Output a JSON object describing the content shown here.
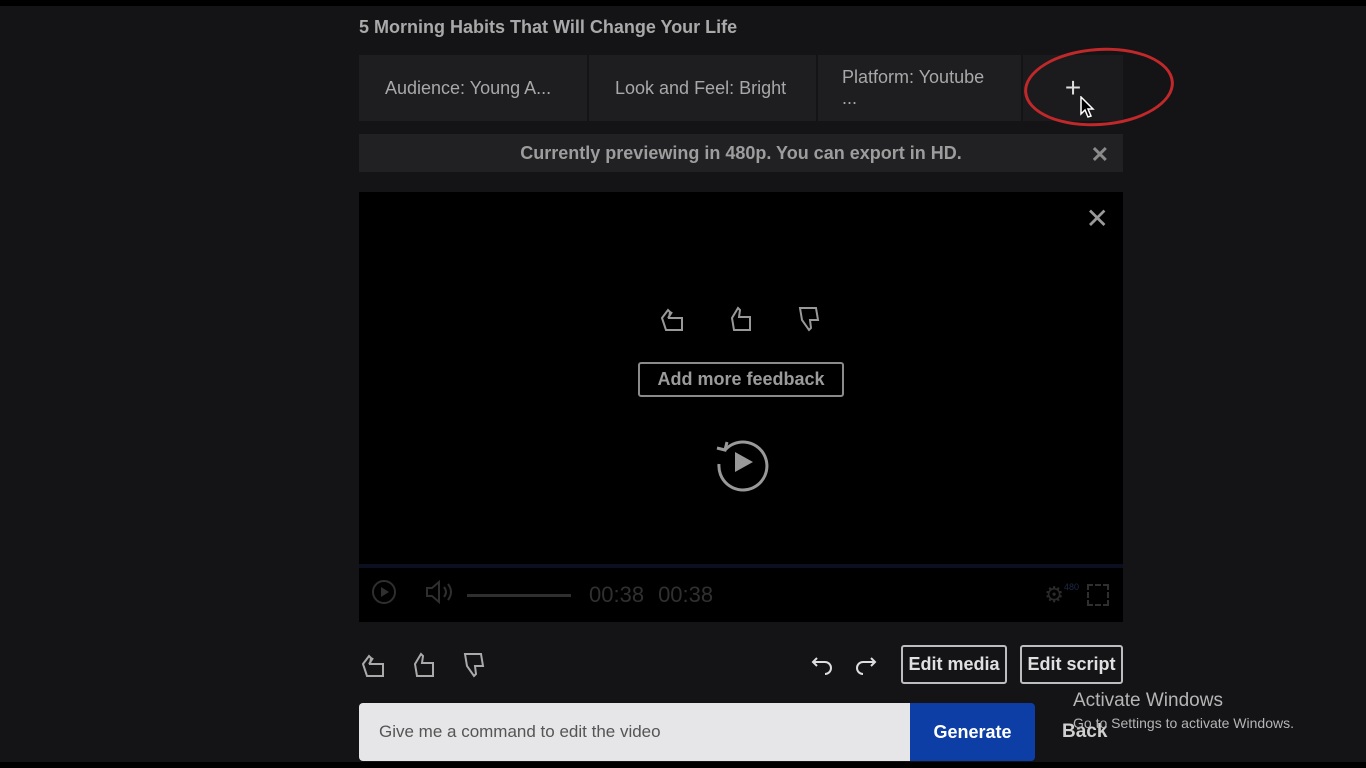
{
  "title": "5 Morning Habits That Will Change Your Life",
  "tabs": [
    {
      "label": "Audience: Young A..."
    },
    {
      "label": "Look and Feel: Bright"
    },
    {
      "label": "Platform: Youtube ..."
    }
  ],
  "add_tab": "+",
  "notice": {
    "text": "Currently previewing in 480p. You can export in HD.",
    "close": "✕"
  },
  "video": {
    "close": "✕",
    "add_feedback": "Add more feedback",
    "current_time": "00:38",
    "duration": "00:38",
    "quality": "480"
  },
  "toolbar": {
    "edit_media": "Edit media",
    "edit_script": "Edit script"
  },
  "command": {
    "placeholder": "Give me a command to edit the video",
    "generate": "Generate",
    "back": "Back"
  },
  "watermark": {
    "title": "Activate Windows",
    "subtitle": "Go to Settings to activate Windows."
  }
}
